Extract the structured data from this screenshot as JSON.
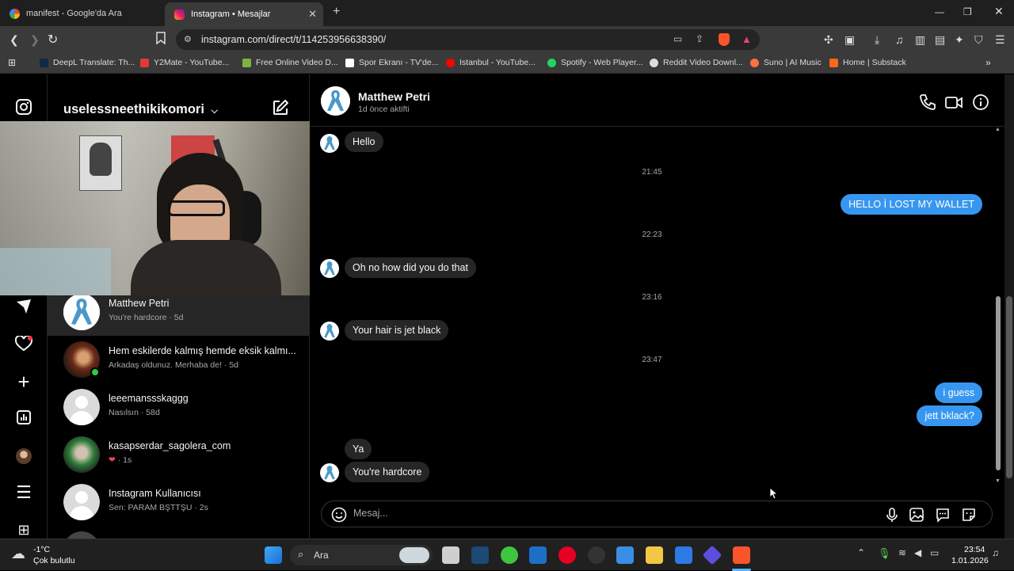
{
  "browser": {
    "tabs": [
      {
        "title": "manifest - Google'da Ara",
        "active": false
      },
      {
        "title": "Instagram • Mesajlar",
        "active": true
      }
    ],
    "url": "instagram.com/direct/t/114253956638390/",
    "bookmarks": [
      {
        "label": "DeepL Translate: Th...",
        "color": "#0f2b46"
      },
      {
        "label": "Y2Mate - YouTube...",
        "color": "#e53935"
      },
      {
        "label": "Free Online Video D...",
        "color": "#7cb342"
      },
      {
        "label": "Spor Ekranı - TV'de...",
        "color": "#ffffff"
      },
      {
        "label": "Istanbul - YouTube...",
        "color": "#ff0000"
      },
      {
        "label": "Spotify - Web Player...",
        "color": "#1ed760"
      },
      {
        "label": "Reddit Video Downl...",
        "color": "#dddddd"
      },
      {
        "label": "Suno | AI Music",
        "color": "#ff7043"
      },
      {
        "label": "Home | Substack",
        "color": "#ff6719"
      }
    ]
  },
  "instagram": {
    "username": "uselessneethikikomori",
    "conversations": [
      {
        "name": "Matthew Petri",
        "preview": "You're hardcore · 5d",
        "active": true,
        "avatar": "ribbon"
      },
      {
        "name": "Hem eskilerde kalmış hemde eksik kalmı...",
        "preview": "Arkadaş oldunuz. Merhaba de! · 5d",
        "active": false,
        "avatar": "photo-red"
      },
      {
        "name": "leeemanssskaggg",
        "preview": "Nasılsın · 58d",
        "active": false,
        "avatar": "default"
      },
      {
        "name": "kasapserdar_sagolera_com",
        "preview": "1s",
        "active": false,
        "avatar": "photo-green"
      },
      {
        "name": "Instagram Kullanıcısı",
        "preview": "Sen: PARAM BŞTTŞU · 2s",
        "active": false,
        "avatar": "default"
      }
    ],
    "chat": {
      "peer_name": "Matthew Petri",
      "peer_status": "1d önce aktifti",
      "messages": [
        {
          "type": "in",
          "text": "Hello"
        },
        {
          "type": "time",
          "text": "21:45"
        },
        {
          "type": "out",
          "text": "HELLO İ LOST MY WALLET"
        },
        {
          "type": "time",
          "text": "22:23"
        },
        {
          "type": "in",
          "text": "Oh no how did you do that"
        },
        {
          "type": "time",
          "text": "23:16"
        },
        {
          "type": "in",
          "text": "Your hair is jet black"
        },
        {
          "type": "time",
          "text": "23:47"
        },
        {
          "type": "out",
          "text": "i guess"
        },
        {
          "type": "out",
          "text": "jett  bklack?"
        },
        {
          "type": "in",
          "text": "Ya"
        },
        {
          "type": "in",
          "text": "You're hardcore"
        }
      ],
      "composer_placeholder": "Mesaj..."
    },
    "accent_color": "#3797f0"
  },
  "taskbar": {
    "weather_temp": "-1°C",
    "weather_desc": "Çok bulutlu",
    "search_label": "Ara",
    "time": "23:54",
    "date": "1.01.2026"
  }
}
